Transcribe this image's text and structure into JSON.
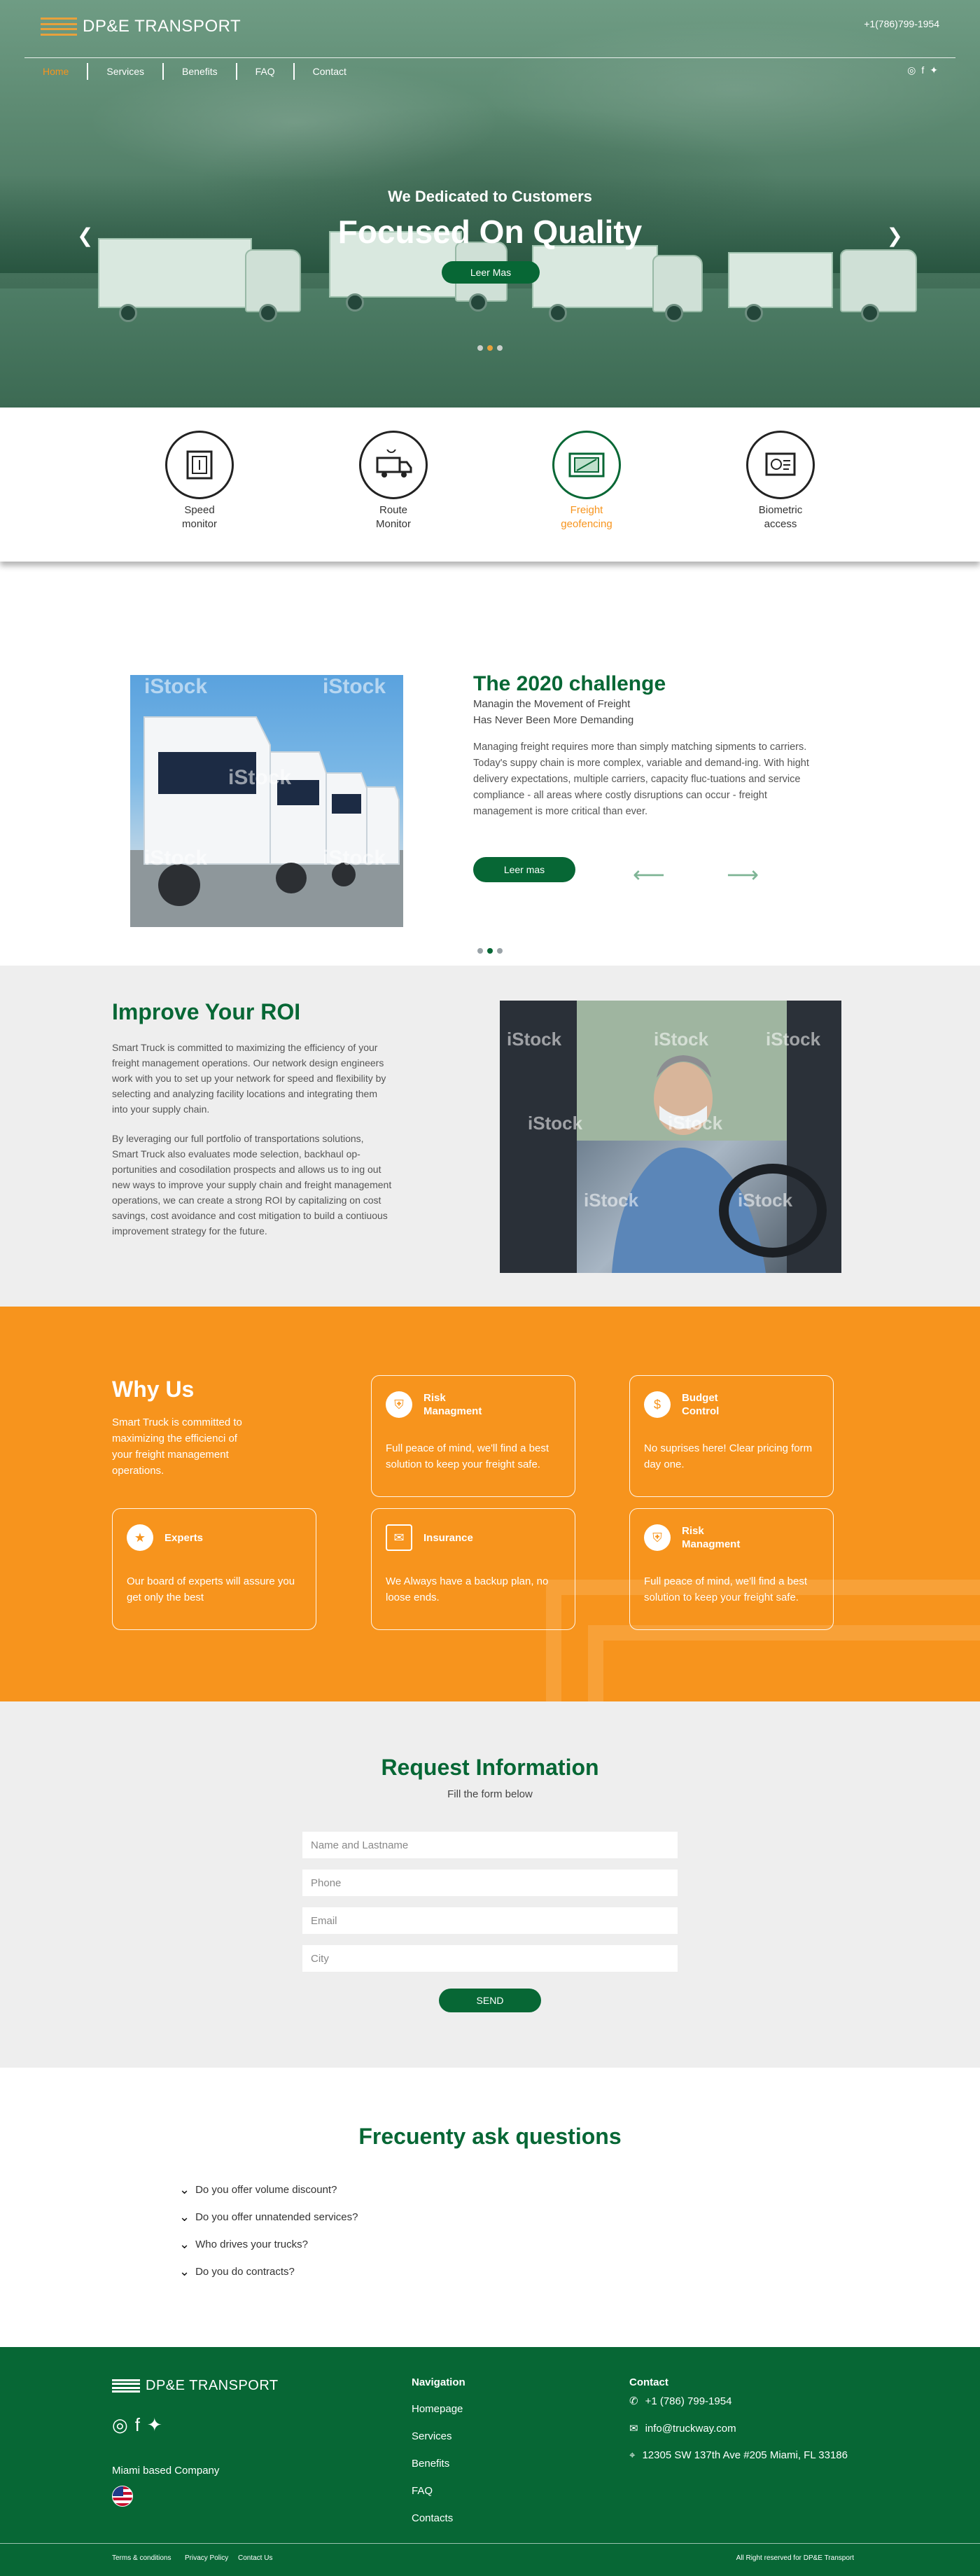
{
  "brand": {
    "name": "DP&E TRANSPORT",
    "phone": "+1(786)799-1954"
  },
  "nav": {
    "items": [
      "Home",
      "Services",
      "Benefits",
      "FAQ",
      "Contact"
    ]
  },
  "social": {
    "icons": [
      "instagram-icon",
      "facebook-icon",
      "twitter-icon"
    ],
    "glyphs": [
      "◎",
      "f",
      "🐦"
    ]
  },
  "hero": {
    "subtitle": "We Dedicated to Customers",
    "title": "Focused On Quality",
    "button": "Leer Mas",
    "prev": "❮",
    "next": "❯"
  },
  "features": [
    {
      "label": "Speed\nmonitor",
      "icon": "speed-monitor-icon",
      "active": false
    },
    {
      "label": "Route\nMonitor",
      "icon": "route-monitor-icon",
      "active": false
    },
    {
      "label": "Freight\ngeofencing",
      "icon": "freight-geofencing-icon",
      "active": true
    },
    {
      "label": "Biometric\naccess",
      "icon": "biometric-access-icon",
      "active": false
    }
  ],
  "challenge": {
    "watermark": "iStock",
    "title": "The 2020 challenge",
    "subtitle": "Managin the Movement of Freight\nHas Never Been More Demanding",
    "text": "Managing freight requires more than simply matching sipments to carriers. Today's suppy chain is more complex, variable and demand-ing. With hight delivery expectations, multiple carriers, capacity fluc-tuations and service compliance - all areas where costly disruptions can occur - freight management is more critical than ever.",
    "button": "Leer mas",
    "prev": "⟵",
    "next": "⟶"
  },
  "roi": {
    "title": "Improve Your ROI",
    "p1": "Smart Truck is committed to maximizing the efficiency of your freight management operations. Our network design engineers work with you to set up your network for speed and flexibility by selecting and analyzing facility locations and integrating them into your supply chain.",
    "p2": "By leveraging our full portfolio of transportations solutions, Smart Truck also evaluates mode selection, backhaul op-portunities and cosodilation prospects and allows us to ing out new ways to improve your supply chain and freight management operations, we can create a strong ROI by capitalizing on cost savings, cost avoidance and cost mitigation to build a contiuous improvement strategy for the future."
  },
  "why": {
    "title": "Why Us",
    "intro": "Smart Truck is committed to maximizing the efficienci of your freight management operations.",
    "cards": [
      {
        "title": "Risk\nManagment",
        "text": "Full peace of mind, we'll find a best solution to keep your freight safe.",
        "icon": "risk-icon"
      },
      {
        "title": "Budget\nControl",
        "text": "No suprises here! Clear pricing form day one.",
        "icon": "budget-icon"
      },
      {
        "title": "Experts",
        "text": "Our board of experts will assure you get only the best",
        "icon": "experts-icon"
      },
      {
        "title": "Insurance",
        "text": "We Always have a backup plan, no loose ends.",
        "icon": "insurance-icon"
      },
      {
        "title": "Risk\nManagment",
        "text": "Full peace of mind, we'll find a best solution to keep your freight safe.",
        "icon": "risk-icon"
      }
    ]
  },
  "request": {
    "title": "Request Information",
    "subtitle": "Fill the form below",
    "fields": [
      "Name and Lastname",
      "Phone",
      "Email",
      "City"
    ],
    "button": "SEND"
  },
  "faq": {
    "title": "Frecuenty ask questions",
    "items": [
      "Do you offer volume discount?",
      "Do you offer unnatended services?",
      "Who drives your trucks?",
      "Do you do contracts?"
    ]
  },
  "footer": {
    "based": "Miami based Company",
    "nav_title": "Navigation",
    "nav": [
      "Homepage",
      "Services",
      "Benefits",
      "FAQ",
      "Contacts"
    ],
    "contact_title": "Contact",
    "phone": "+1 (786) 799-1954",
    "email": "info@truckway.com",
    "address": "12305 SW 137th Ave #205 Miami, FL 33186",
    "legal": [
      "Terms & conditions",
      "Privacy Policy",
      "Contact Us"
    ],
    "rights": "All Right reserved for DP&E Transport"
  },
  "colors": {
    "green": "#076735",
    "orange": "#f7941d",
    "gray": "#eeeeee"
  }
}
